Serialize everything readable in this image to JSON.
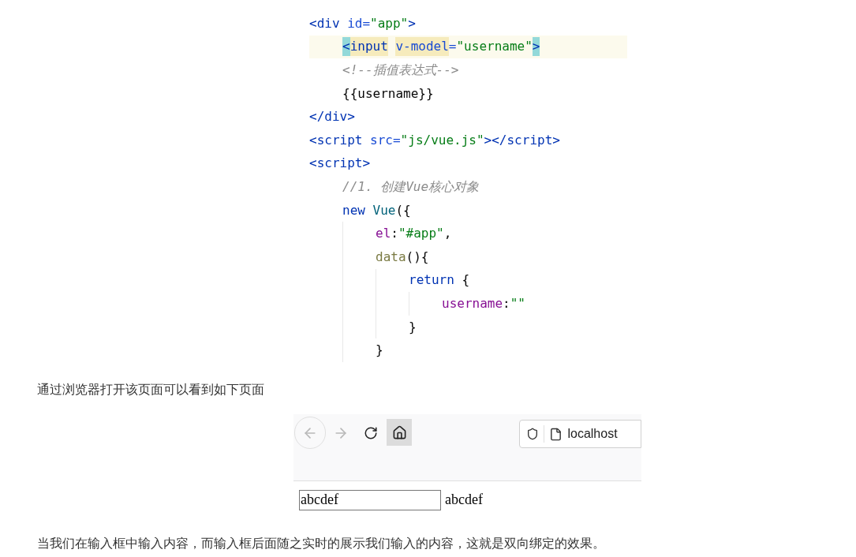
{
  "code_block": {
    "lines": [
      {
        "tokens": [
          {
            "text": "<div",
            "kind": "tag"
          },
          {
            "text": " id=",
            "kind": "attr"
          },
          {
            "text": "\"app\"",
            "kind": "string"
          },
          {
            "text": ">",
            "kind": "tag"
          }
        ],
        "highlighted": false,
        "children": [
          {
            "tokens": [
              {
                "text": "<",
                "kind": "tag",
                "brace_match": true
              },
              {
                "text": "input",
                "kind": "tag",
                "usage_highlight": true
              },
              {
                "text": "v-model",
                "kind": "attr",
                "usage_highlight": true,
                "space_before": true
              },
              {
                "text": "=",
                "kind": "attr"
              },
              {
                "text": "\"username\"",
                "kind": "string"
              },
              {
                "text": ">",
                "kind": "tag",
                "brace_match": true
              }
            ],
            "highlighted": true
          },
          {
            "tokens": [
              {
                "text": "<!--插值表达式-->",
                "kind": "comment"
              }
            ],
            "highlighted": false
          },
          {
            "tokens": [
              {
                "text": "{{username}}",
                "kind": "plain"
              }
            ],
            "highlighted": false
          }
        ]
      },
      {
        "tokens": [
          {
            "text": "</div>",
            "kind": "tag"
          }
        ],
        "highlighted": false
      },
      {
        "tokens": [
          {
            "text": "<script",
            "kind": "tag"
          },
          {
            "text": " src=",
            "kind": "attr"
          },
          {
            "text": "\"js/vue.js\"",
            "kind": "string"
          },
          {
            "text": "></script>",
            "kind": "tag"
          }
        ],
        "highlighted": false
      },
      {
        "tokens": [
          {
            "text": "<script>",
            "kind": "tag"
          }
        ],
        "highlighted": false,
        "children": [
          {
            "tokens": [
              {
                "text": "//1. 创建Vue核心对象",
                "kind": "comment"
              }
            ],
            "highlighted": false
          },
          {
            "tokens": [
              {
                "text": "new",
                "kind": "keyword"
              },
              {
                "text": "Vue",
                "kind": "func_blue",
                "space_before": true
              },
              {
                "text": "({",
                "kind": "plain"
              }
            ],
            "highlighted": false,
            "children": [
              {
                "tokens": [
                  {
                    "text": "el",
                    "kind": "prop"
                  },
                  {
                    "text": ":",
                    "kind": "plain"
                  },
                  {
                    "text": "\"#app\"",
                    "kind": "string"
                  },
                  {
                    "text": ",",
                    "kind": "plain"
                  }
                ],
                "highlighted": false
              },
              {
                "tokens": [
                  {
                    "text": "data",
                    "kind": "func"
                  },
                  {
                    "text": "(){",
                    "kind": "plain"
                  }
                ],
                "highlighted": false,
                "children": [
                  {
                    "tokens": [
                      {
                        "text": "return",
                        "kind": "keyword"
                      },
                      {
                        "text": " {",
                        "kind": "plain"
                      }
                    ],
                    "highlighted": false,
                    "children": [
                      {
                        "tokens": [
                          {
                            "text": "username",
                            "kind": "prop"
                          },
                          {
                            "text": ":",
                            "kind": "plain"
                          },
                          {
                            "text": "\"\"",
                            "kind": "string"
                          }
                        ],
                        "highlighted": false
                      }
                    ]
                  },
                  {
                    "tokens": [
                      {
                        "text": "}",
                        "kind": "plain"
                      }
                    ],
                    "highlighted": false
                  }
                ]
              },
              {
                "tokens": [
                  {
                    "text": "}",
                    "kind": "plain"
                  }
                ],
                "highlighted": false
              }
            ]
          }
        ]
      }
    ]
  },
  "intro": "通过浏览器打开该页面可以看到如下页面",
  "browser": {
    "url": "localhost",
    "input": {
      "value": "abcdef"
    },
    "output": "abcdef"
  },
  "conclusion": "当我们在输入框中输入内容，而输入框后面随之实时的展示我们输入的内容，这就是双向绑定的效果。"
}
